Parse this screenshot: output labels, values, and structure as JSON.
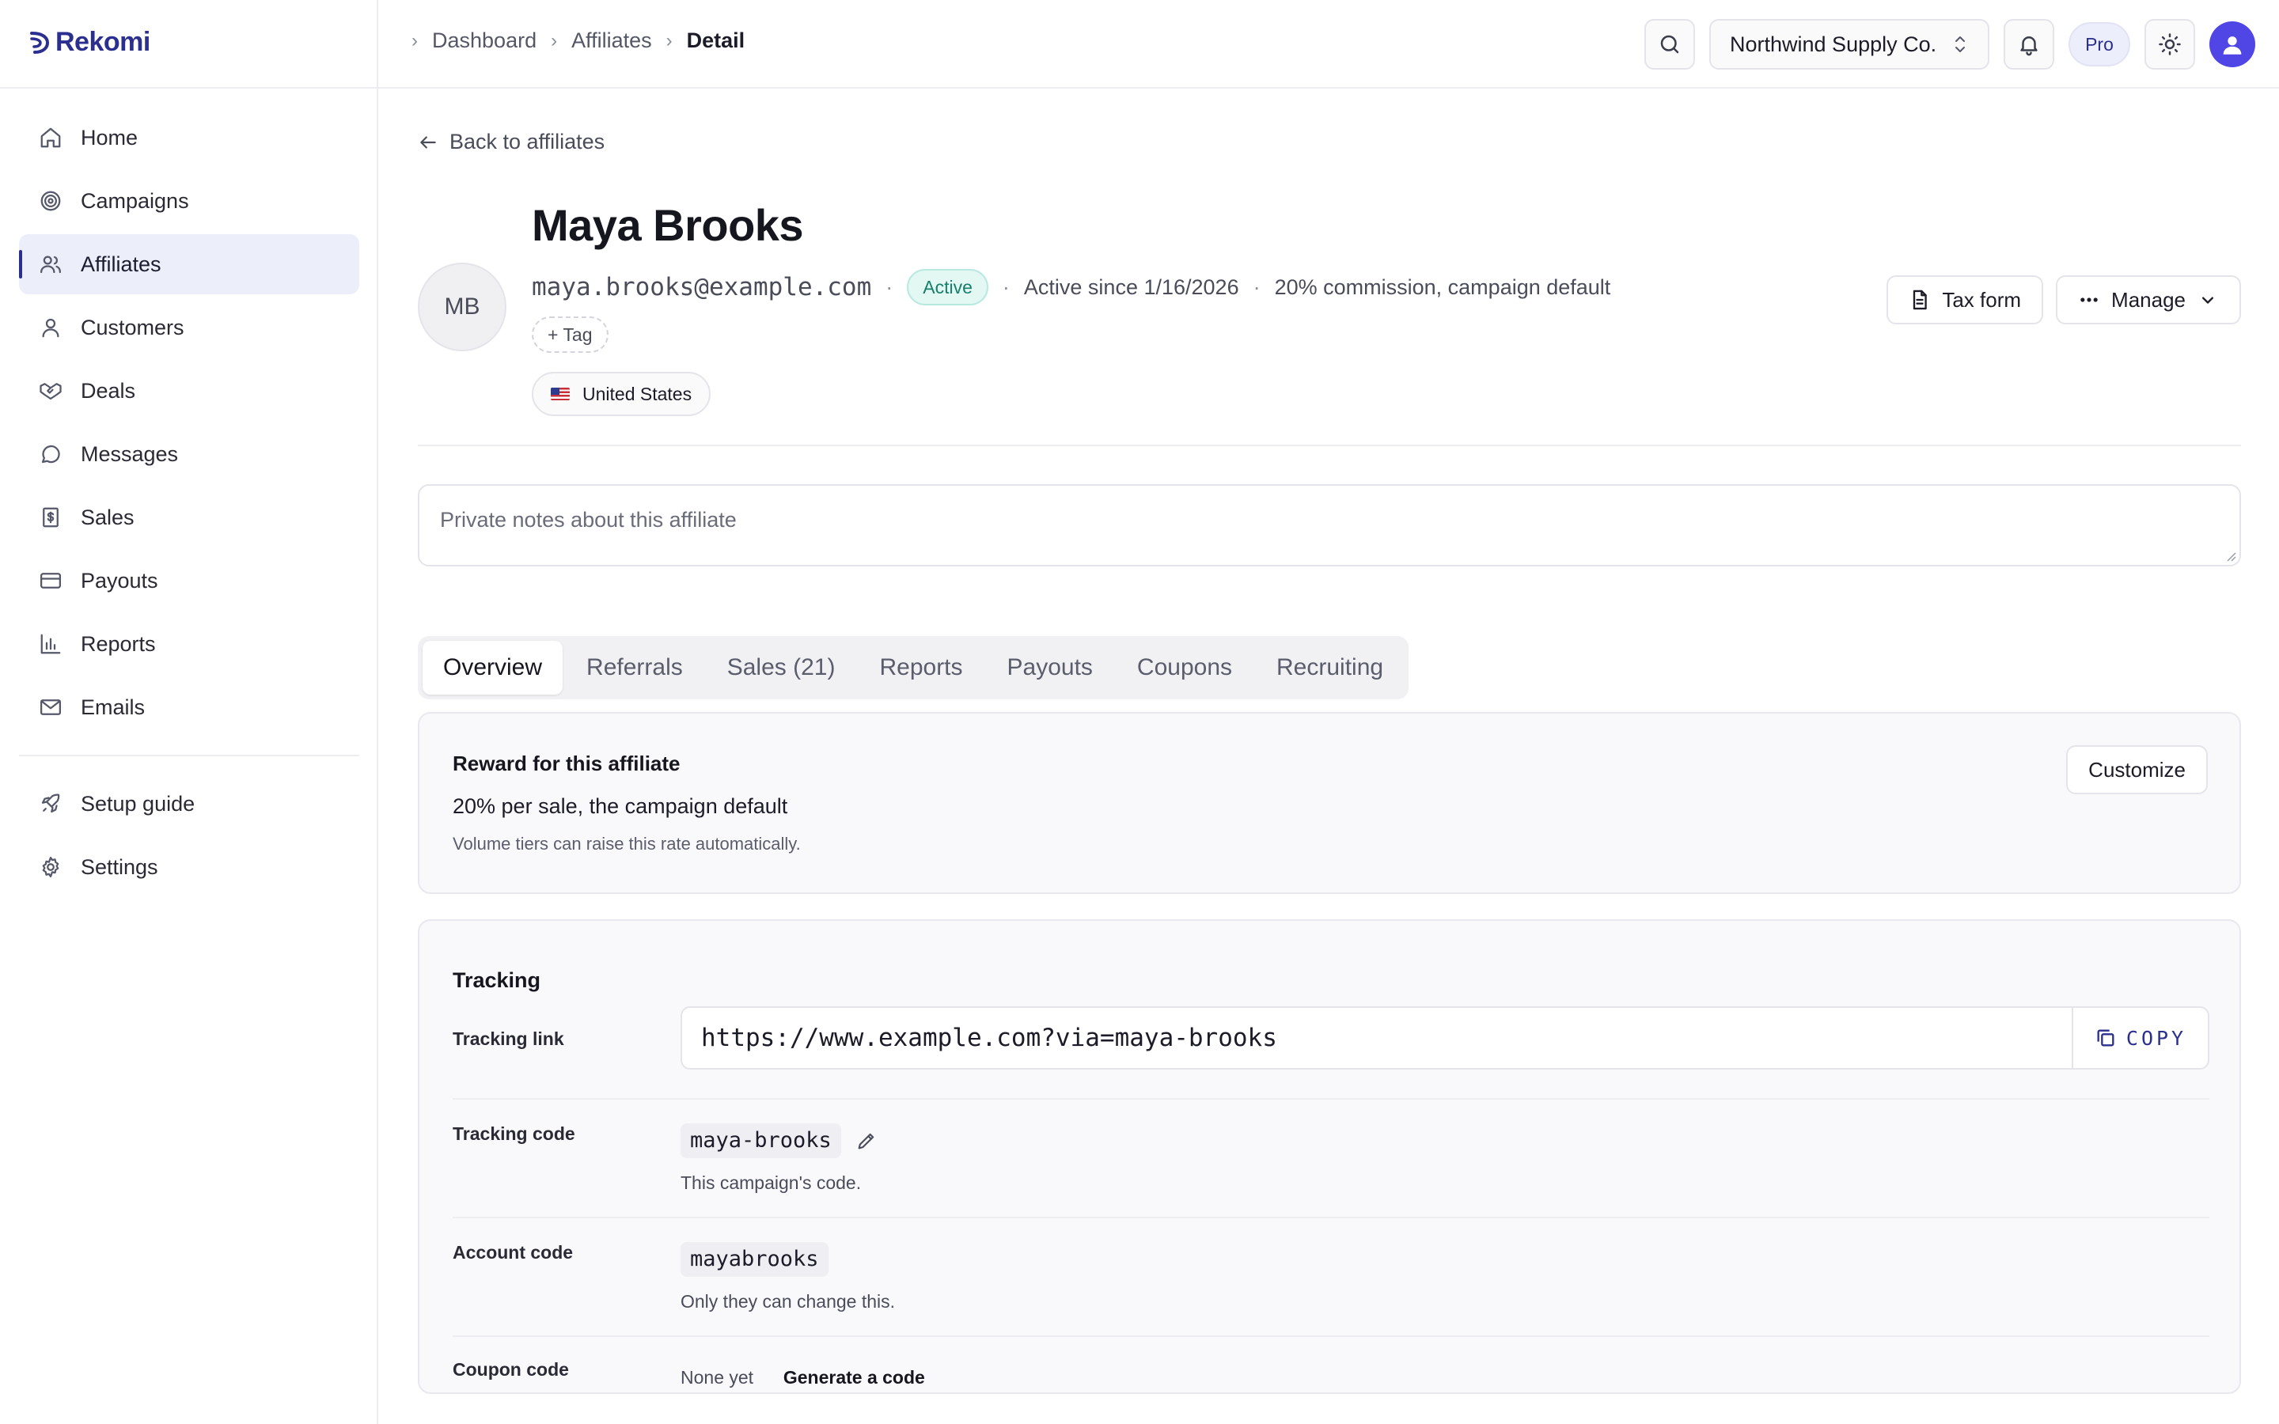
{
  "brand": {
    "name": "Rekomi",
    "accent": "#2b2f8f",
    "success": "#17806a"
  },
  "sidebar": {
    "items": [
      {
        "label": "Home",
        "icon": "home-icon"
      },
      {
        "label": "Campaigns",
        "icon": "target-icon"
      },
      {
        "label": "Affiliates",
        "icon": "users-icon",
        "active": true
      },
      {
        "label": "Customers",
        "icon": "user-icon"
      },
      {
        "label": "Deals",
        "icon": "handshake-icon"
      },
      {
        "label": "Messages",
        "icon": "message-icon"
      },
      {
        "label": "Sales",
        "icon": "receipt-icon"
      },
      {
        "label": "Payouts",
        "icon": "card-icon"
      },
      {
        "label": "Reports",
        "icon": "bar-chart-icon"
      },
      {
        "label": "Emails",
        "icon": "mail-icon"
      }
    ],
    "secondary": [
      {
        "label": "Setup guide",
        "icon": "rocket-icon"
      },
      {
        "label": "Settings",
        "icon": "gear-icon"
      }
    ]
  },
  "header": {
    "breadcrumb": [
      "Dashboard",
      "Affiliates",
      "Detail"
    ],
    "org": "Northwind Supply Co.",
    "plan": "Pro"
  },
  "main": {
    "back": "Back to affiliates",
    "profile": {
      "initials": "MB",
      "name": "Maya Brooks",
      "email": "maya.brooks@example.com",
      "status": "Active",
      "since": "Active since 1/16/2026",
      "commission": "20% commission, campaign default",
      "tag_button": "+ Tag",
      "country": "United States",
      "tax_button": "Tax form",
      "manage_button": "Manage"
    },
    "notes_placeholder": "Private notes about this affiliate",
    "tabs": [
      "Overview",
      "Referrals",
      "Sales (21)",
      "Reports",
      "Payouts",
      "Coupons",
      "Recruiting"
    ],
    "reward": {
      "title": "Reward for this affiliate",
      "line": "20% per sale, the campaign default",
      "sub": "Volume tiers can raise this rate automatically.",
      "button": "Customize"
    },
    "tracking": {
      "title": "Tracking",
      "link_label": "Tracking link",
      "link": "https://www.example.com?via=maya-brooks",
      "copy": "COPY",
      "code_label": "Tracking code",
      "code": "maya-brooks",
      "code_help": "This campaign's code.",
      "account_label": "Account code",
      "account_code": "mayabrooks",
      "account_help": "Only they can change this.",
      "coupon_label": "Coupon code",
      "coupon_value": "None yet",
      "coupon_action": "Generate a code"
    }
  }
}
